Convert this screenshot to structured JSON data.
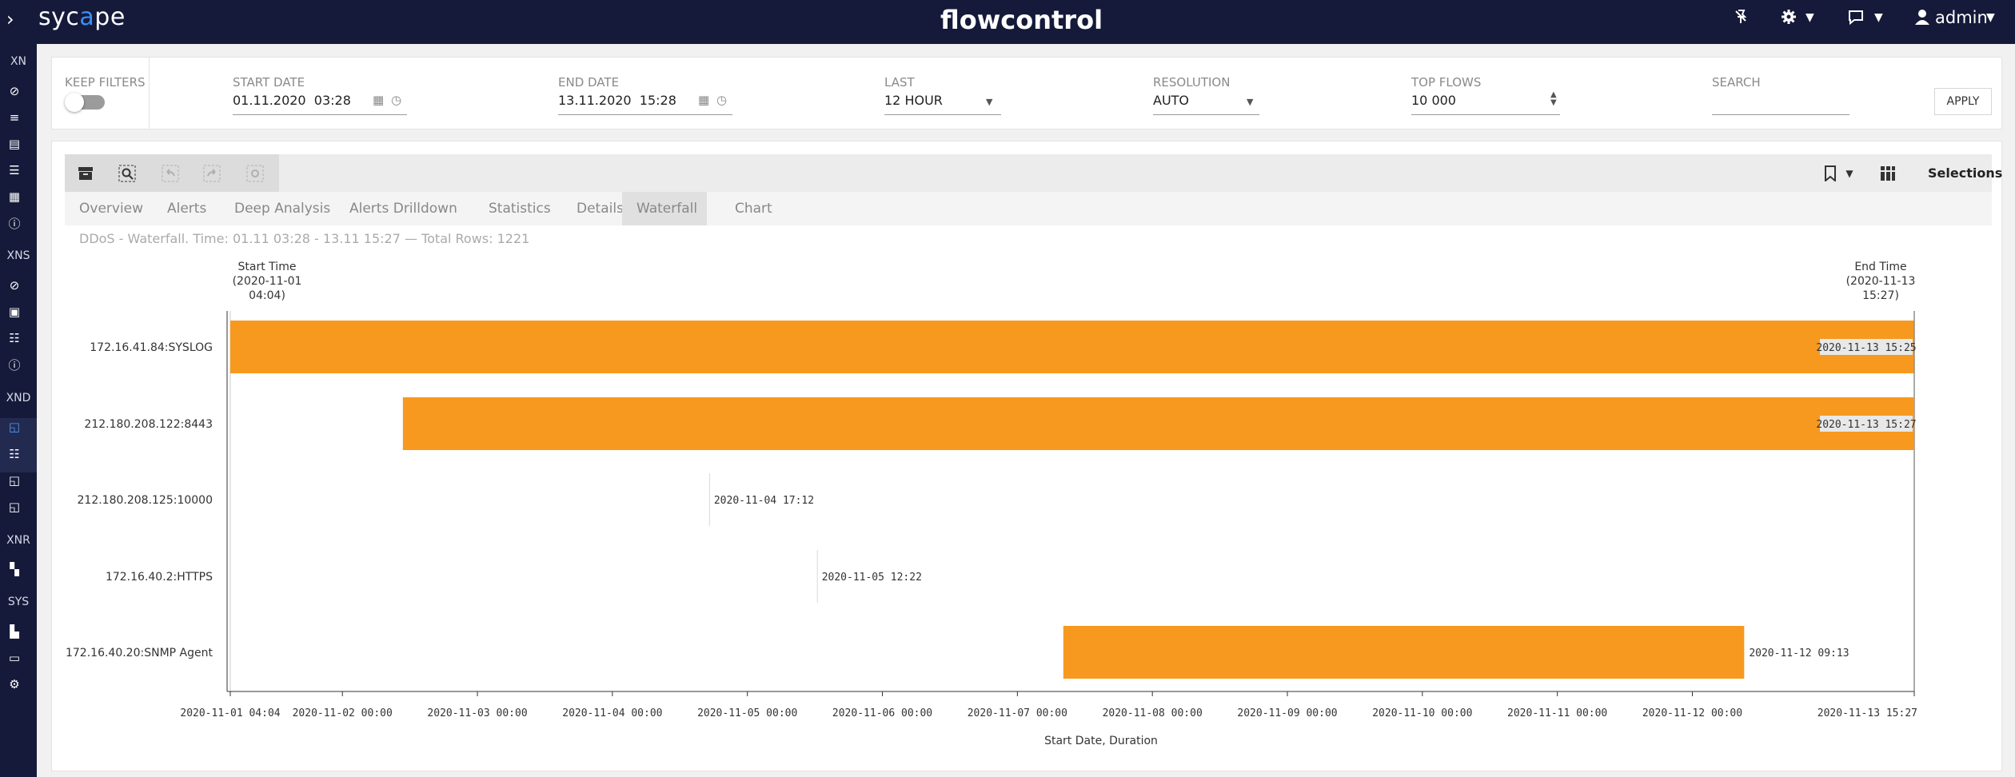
{
  "topbar": {
    "logo_left": "syc",
    "logo_accent": "a",
    "logo_right": "pe",
    "app_title": "flowcontrol",
    "user_label": "admin",
    "icons": [
      "sidebar-expand-icon",
      "pin-off-icon",
      "gear-icon",
      "chat-icon",
      "user-icon",
      "chevron-down-icon"
    ]
  },
  "sidebar": {
    "sections": [
      "XN",
      "XNS",
      "XND",
      "XNR",
      "SYS"
    ],
    "active_color": "#4b9bff"
  },
  "filters": {
    "keep_filters_label": "KEEP FILTERS",
    "keep_filters_on": false,
    "start_date_label": "START DATE",
    "start_date_value": "01.11.2020  03:28",
    "end_date_label": "END DATE",
    "end_date_value": "13.11.2020  15:28",
    "last_label": "LAST",
    "last_value": "12 HOUR",
    "resolution_label": "RESOLUTION",
    "resolution_value": "AUTO",
    "top_flows_label": "TOP FLOWS",
    "top_flows_value": "10 000",
    "search_label": "SEARCH",
    "search_value": "",
    "apply_label": "APPLY"
  },
  "toolbar": {
    "selections_label": "Selections",
    "icons": [
      "archive-icon",
      "zoom-search-icon",
      "undo-icon",
      "redo-icon",
      "settings-icon",
      "bookmark-icon",
      "grid-icon"
    ]
  },
  "tabs": [
    "Overview",
    "Alerts",
    "Deep Analysis",
    "Alerts Drilldown",
    "Statistics",
    "Details",
    "Waterfall",
    "Chart"
  ],
  "active_tab": "Waterfall",
  "subtitle": "DDoS - Waterfall. Time: 01.11 03:28 - 13.11 15:27 — Total Rows: 1221",
  "chart_data": {
    "type": "bar",
    "bar_color": "#f7991f",
    "start_header": [
      "Start Time",
      "(2020-11-01",
      "04:04)"
    ],
    "end_header": [
      "End Time",
      "(2020-11-13",
      "15:27)"
    ],
    "x_start": "2020-11-01 04:04",
    "x_end": "2020-11-13 15:27",
    "xlabel": "Start Date, Duration",
    "xticks": [
      "2020-11-01 04:04",
      "2020-11-02 00:00",
      "2020-11-03 00:00",
      "2020-11-04 00:00",
      "2020-11-05 00:00",
      "2020-11-06 00:00",
      "2020-11-07 00:00",
      "2020-11-08 00:00",
      "2020-11-09 00:00",
      "2020-11-10 00:00",
      "2020-11-11 00:00",
      "2020-11-12 00:00",
      "2020-11-13 15:27"
    ],
    "rows": [
      {
        "label": "172.16.41.84:SYSLOG",
        "start": "2020-11-01 04:04",
        "end": "2020-11-13 15:25",
        "end_label": "2020-11-13 15:25"
      },
      {
        "label": "212.180.208.122:8443",
        "start": "2020-11-02 10:45",
        "end": "2020-11-13 15:27",
        "end_label": "2020-11-13 15:27"
      },
      {
        "label": "212.180.208.125:10000",
        "start": "2020-11-04 17:12",
        "end": "2020-11-04 17:12",
        "end_label": "2020-11-04 17:12"
      },
      {
        "label": "172.16.40.2:HTTPS",
        "start": "2020-11-05 12:22",
        "end": "2020-11-05 12:22",
        "end_label": "2020-11-05 12:22"
      },
      {
        "label": "172.16.40.20:SNMP Agent",
        "start": "2020-11-07 08:10",
        "end": "2020-11-12 09:13",
        "end_label": "2020-11-12 09:13"
      }
    ]
  }
}
